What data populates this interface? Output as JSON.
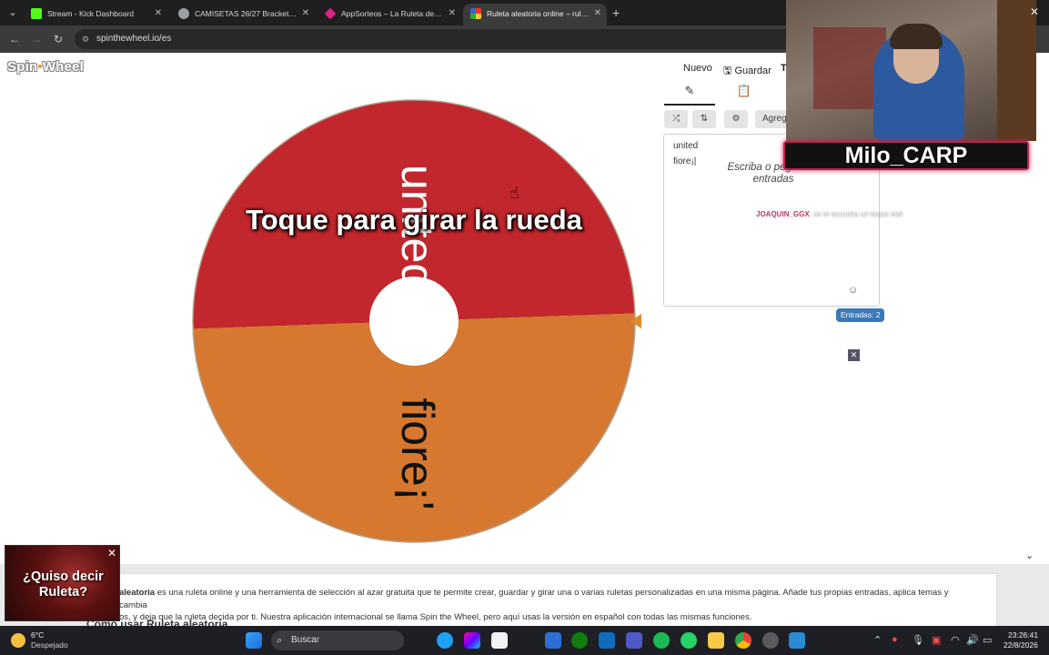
{
  "browser": {
    "tabs": [
      {
        "title": "Stream - Kick Dashboard",
        "favicon_color": "#53fc18",
        "active": false
      },
      {
        "title": "CAMISETAS 26/27 Bracket - Bra",
        "favicon_color": "#9aa0a6",
        "active": false
      },
      {
        "title": "AppSorteos – La Ruleta de la S",
        "favicon_color": "#e0208a",
        "active": false
      },
      {
        "title": "Ruleta aleatoria online – ruleta",
        "favicon_color": "#4285f4",
        "active": true
      }
    ],
    "url": "spinthewheel.io/es"
  },
  "page": {
    "logo": {
      "part1": "Spin",
      "dot": "•",
      "part2": "Wheel"
    },
    "actions": {
      "new_label": "Nuevo",
      "save_label": "Guardar",
      "more_label": "T"
    },
    "wheel": {
      "caption": "Toque para girar la rueda",
      "segments": [
        {
          "label": "united",
          "color": "#c1272d"
        },
        {
          "label": "fiore¡'",
          "color": "#d6782f"
        }
      ],
      "pointer_color": "#e08a2c"
    },
    "panel": {
      "tab_icons": [
        "pencil-icon",
        "clipboard-icon"
      ],
      "tools": [
        "shuffle-icon",
        "sort-icon",
        "settings-icon"
      ],
      "add_label": "Agreg",
      "entries": [
        "united",
        "fiore¡|"
      ],
      "hint": "Escriba o pegue las entradas",
      "entries_count_label": "Entradas: 2"
    },
    "chat": {
      "user": "JOAQUIN_GGX",
      "message": ": se te escucha un toque mal"
    },
    "info": {
      "text_bold": "aleatoria",
      "text": " es una ruleta online y una herramienta de selección al azar gratuita que te permite crear, guardar y girar una o varias ruletas personalizadas en una misma página. Añade tus propias entradas, aplica temas y cambia",
      "text2": "os, y deja que la ruleta decida por ti. Nuestra aplicación internacional se llama Spin the Wheel, pero aquí usas la versión en español con todas las mismas funciones.",
      "heading": "Cómo usar Ruleta aleatoria"
    },
    "ad": {
      "text": "¿Quiso decir Ruleta?"
    }
  },
  "overlay": {
    "streamer_name": "Milo_CARP"
  },
  "taskbar": {
    "weather_temp": "6°C",
    "weather_desc": "Despejado",
    "search_label": "Buscar",
    "time": "23:26:41",
    "date": "22/8/2026"
  }
}
